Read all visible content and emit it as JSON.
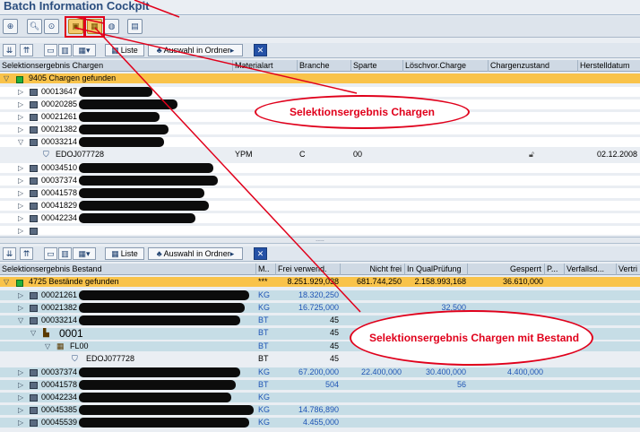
{
  "app": {
    "title": "Batch Information Cockpit"
  },
  "grid_toolbar": {
    "liste_label": "Liste",
    "auswahl_label": "Auswahl in Ordner"
  },
  "upper": {
    "headers": [
      "Selektionsergebnis Chargen",
      "Materialart",
      "Branche",
      "Sparte",
      "Löschvor.Charge",
      "Chargenzustand",
      "Herstelldatum"
    ],
    "summary": "9405 Chargen gefunden",
    "rows": [
      {
        "id": "00013647"
      },
      {
        "id": "00020285"
      },
      {
        "id": "00021261"
      },
      {
        "id": "00021382"
      },
      {
        "id": "00033214"
      }
    ],
    "detail": {
      "id": "EDOJ077728",
      "materialart": "YPM",
      "branche": "C",
      "sparte": "00",
      "herstelldatum": "02.12.2008"
    },
    "rows2": [
      {
        "id": "00034510"
      },
      {
        "id": "00037374"
      },
      {
        "id": "00041578"
      },
      {
        "id": "00041829"
      },
      {
        "id": "00042234"
      }
    ]
  },
  "lower": {
    "headers": [
      "Selektionsergebnis Bestand",
      "M..",
      "Frei verwend.",
      "Nicht frei",
      "In QualPrüfung",
      "Gesperrt",
      "P...",
      "Verfallsd...",
      "Vertri"
    ],
    "summary": {
      "label": "4725 Bestände gefunden",
      "unit": "***",
      "frei": "8.251.929,038",
      "nichtfrei": "681.744,250",
      "qual": "2.158.993,168",
      "gesperrt": "36.610,000"
    },
    "rows": [
      {
        "id": "00021261",
        "unit": "KG",
        "frei": "18.320,250",
        "nichtfrei": "",
        "qual": "",
        "gesperrt": ""
      },
      {
        "id": "00021382",
        "unit": "KG",
        "frei": "16.725,000",
        "nichtfrei": "",
        "qual": "32,500",
        "gesperrt": ""
      },
      {
        "id": "00033214",
        "unit": "BT",
        "frei": "45",
        "nichtfrei": "",
        "qual": "",
        "gesperrt": ""
      }
    ],
    "plant": {
      "id": "0001",
      "unit": "BT",
      "frei": "45"
    },
    "sloc": {
      "id": "FL00",
      "unit": "BT",
      "frei": "45"
    },
    "batch": {
      "id": "EDOJ077728",
      "unit": "BT",
      "frei": "45"
    },
    "rows2": [
      {
        "id": "00037374",
        "unit": "KG",
        "frei": "67.200,000",
        "nichtfrei": "22.400,000",
        "qual": "30.400,000",
        "gesperrt": "4.400,000"
      },
      {
        "id": "00041578",
        "unit": "BT",
        "frei": "504",
        "nichtfrei": "",
        "qual": "56",
        "gesperrt": ""
      },
      {
        "id": "00042234",
        "unit": "KG",
        "frei": "",
        "nichtfrei": "",
        "qual": "",
        "gesperrt": ""
      },
      {
        "id": "00045385",
        "unit": "KG",
        "frei": "14.786,890",
        "nichtfrei": "",
        "qual": "",
        "gesperrt": ""
      },
      {
        "id": "00045539",
        "unit": "KG",
        "frei": "4.455,000",
        "nichtfrei": "",
        "qual": "",
        "gesperrt": ""
      }
    ]
  },
  "callouts": {
    "first": "Selektionsergebnis Chargen",
    "second": "Selektionsergebnis Chargen mit Bestand"
  },
  "colors": {
    "accent": "#e0001b",
    "selection": "#f9c34a",
    "title": "#2a4d7e"
  }
}
